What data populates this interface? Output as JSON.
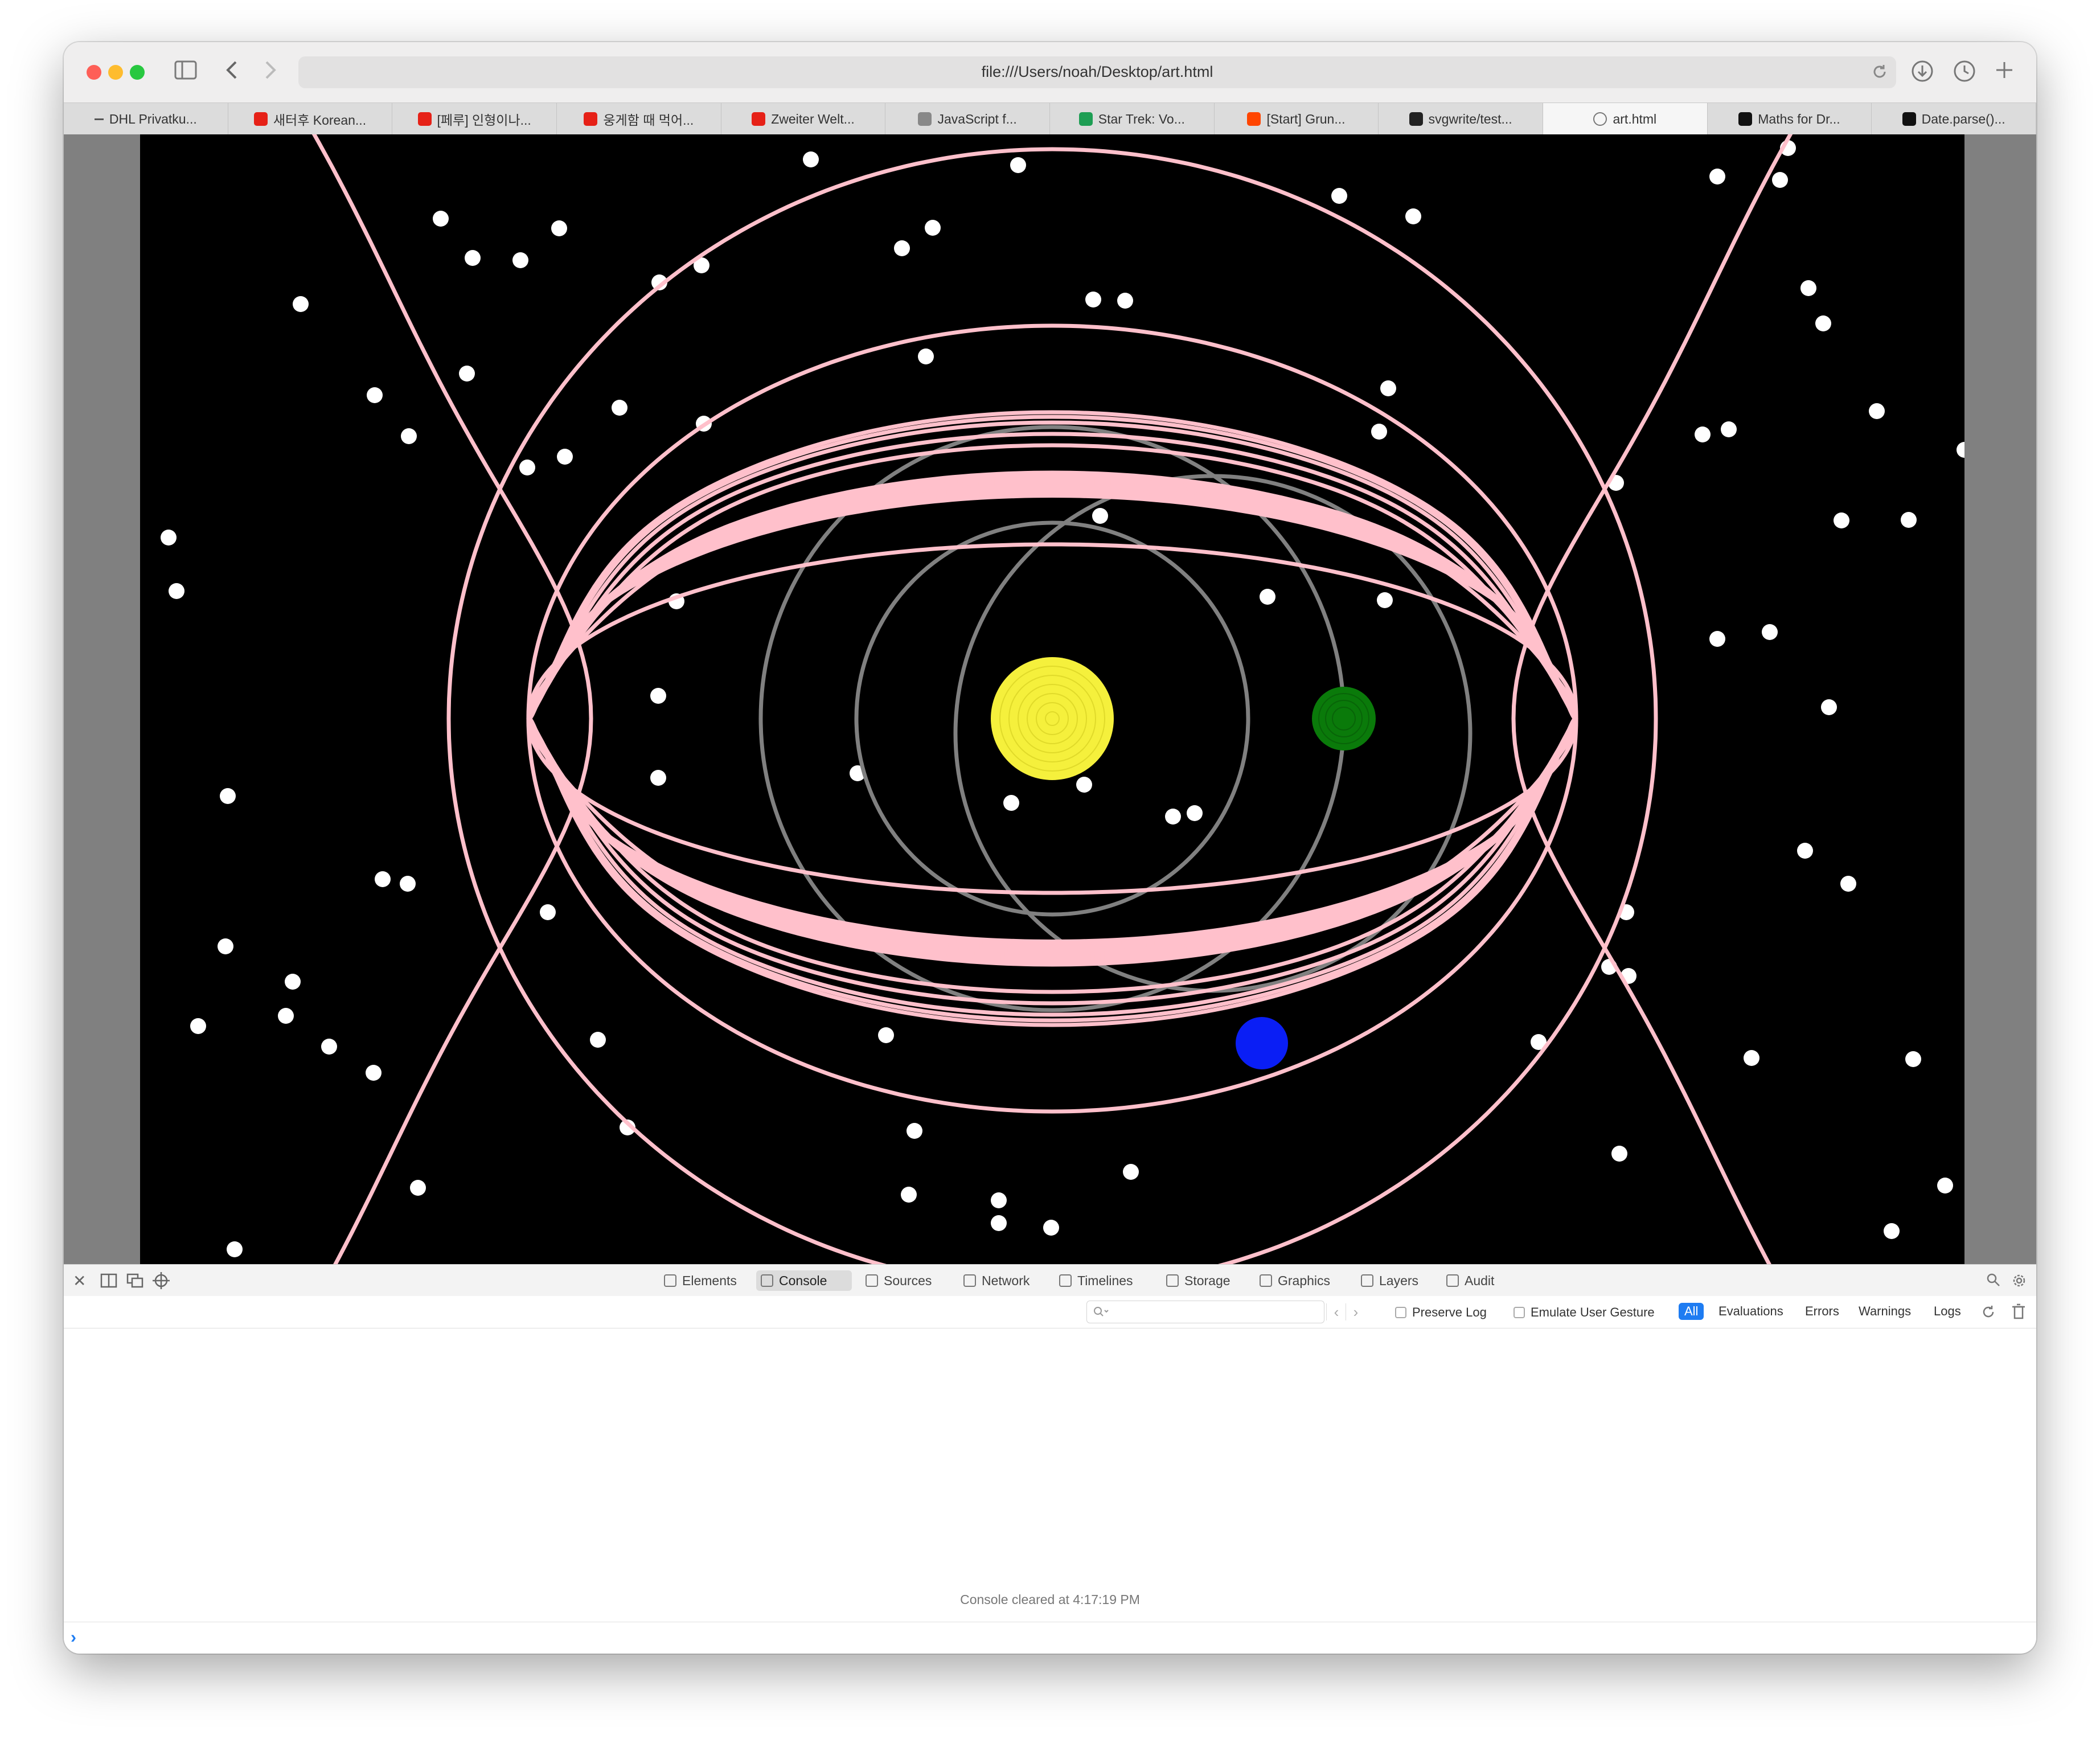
{
  "browser": {
    "url": "file:///Users/noah/Desktop/art.html",
    "tabs": [
      {
        "label": "DHL Privatku...",
        "favicon": "dash-icon",
        "color": "#555555"
      },
      {
        "label": "새터후 Korean...",
        "favicon": "youtube-icon",
        "color": "#e62117"
      },
      {
        "label": "[페루] 인형이나...",
        "favicon": "youtube-icon",
        "color": "#e62117"
      },
      {
        "label": "웅게함 때 먹어...",
        "favicon": "youtube-icon",
        "color": "#e62117"
      },
      {
        "label": "Zweiter Welt...",
        "favicon": "youtube-icon",
        "color": "#e62117"
      },
      {
        "label": "JavaScript f...",
        "favicon": "e-icon",
        "color": "#888888"
      },
      {
        "label": "Star Trek: Vo...",
        "favicon": "sheets-icon",
        "color": "#1e9e54"
      },
      {
        "label": "[Start] Grun...",
        "favicon": "reddit-icon",
        "color": "#ff4500"
      },
      {
        "label": "svgwrite/test...",
        "favicon": "github-icon",
        "color": "#222222"
      },
      {
        "label": "art.html",
        "favicon": "compass-icon",
        "color": "#777777",
        "active": true
      },
      {
        "label": "Maths for Dr...",
        "favicon": "medium-icon",
        "color": "#111111"
      },
      {
        "label": "Date.parse()...",
        "favicon": "mdn-icon",
        "color": "#111111"
      }
    ]
  },
  "art": {
    "background": "#000000",
    "star_color": "#ffffff",
    "orbit_color": "#808080",
    "curve_color": "#ffc0cb",
    "sun_color": "#f5f03c",
    "green_planet_color": "#0a7a0a",
    "blue_planet_color": "#0a1ef5"
  },
  "devtools": {
    "tabs": [
      {
        "label": "Elements"
      },
      {
        "label": "Console",
        "selected": true
      },
      {
        "label": "Sources"
      },
      {
        "label": "Network"
      },
      {
        "label": "Timelines"
      },
      {
        "label": "Storage"
      },
      {
        "label": "Graphics"
      },
      {
        "label": "Layers"
      },
      {
        "label": "Audit"
      }
    ],
    "filter": {
      "search_placeholder": "",
      "preserve_log": "Preserve Log",
      "emulate_gesture": "Emulate User Gesture",
      "levels": [
        "All",
        "Evaluations",
        "Errors",
        "Warnings",
        "Logs"
      ]
    },
    "console_message": "Console cleared at 4:17:19 PM",
    "prompt": "›"
  }
}
